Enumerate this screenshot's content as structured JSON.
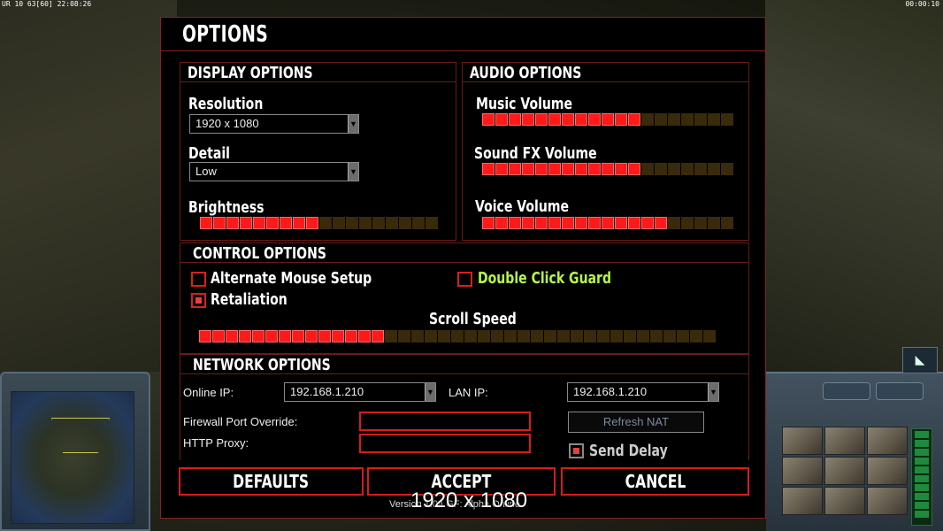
{
  "hud": {
    "top_left": "UR 10 63[60] 22:08:26",
    "top_right": "00:00:10"
  },
  "dialog": {
    "title": "OPTIONS",
    "display": {
      "heading": "DISPLAY OPTIONS",
      "resolution_label": "Resolution",
      "resolution_value": "1920 x 1080",
      "detail_label": "Detail",
      "detail_value": "Low",
      "brightness_label": "Brightness",
      "brightness_level": 0.5
    },
    "audio": {
      "heading": "AUDIO OPTIONS",
      "music_label": "Music Volume",
      "music_level": 0.63,
      "sfx_label": "Sound FX Volume",
      "sfx_level": 0.63,
      "voice_label": "Voice Volume",
      "voice_level": 0.74
    },
    "control": {
      "heading": "CONTROL OPTIONS",
      "alt_mouse_label": "Alternate Mouse Setup",
      "alt_mouse_checked": false,
      "retaliation_label": "Retaliation",
      "retaliation_checked": true,
      "double_click_label": "Double Click Guard",
      "double_click_checked": false,
      "scroll_label": "Scroll Speed",
      "scroll_level": 0.37
    },
    "network": {
      "heading": "NETWORK OPTIONS",
      "online_ip_label": "Online IP:",
      "online_ip_value": "192.168.1.210",
      "lan_ip_label": "LAN IP:",
      "lan_ip_value": "192.168.1.210",
      "firewall_label": "Firewall Port Override:",
      "firewall_value": "",
      "proxy_label": "HTTP Proxy:",
      "proxy_value": "",
      "refresh_nat_label": "Refresh NAT",
      "send_delay_label": "Send Delay",
      "send_delay_checked": true
    },
    "buttons": {
      "defaults": "DEFAULTS",
      "accept": "ACCEPT",
      "cancel": "CANCEL"
    },
    "version": "Version 1.04 GF: Alpha Online"
  },
  "overlay_resolution": "1920 x 1080",
  "colors": {
    "accent_red": "#d81c1c",
    "slider_on": "#ff1a1a",
    "highlight_green": "#b6f54a"
  }
}
